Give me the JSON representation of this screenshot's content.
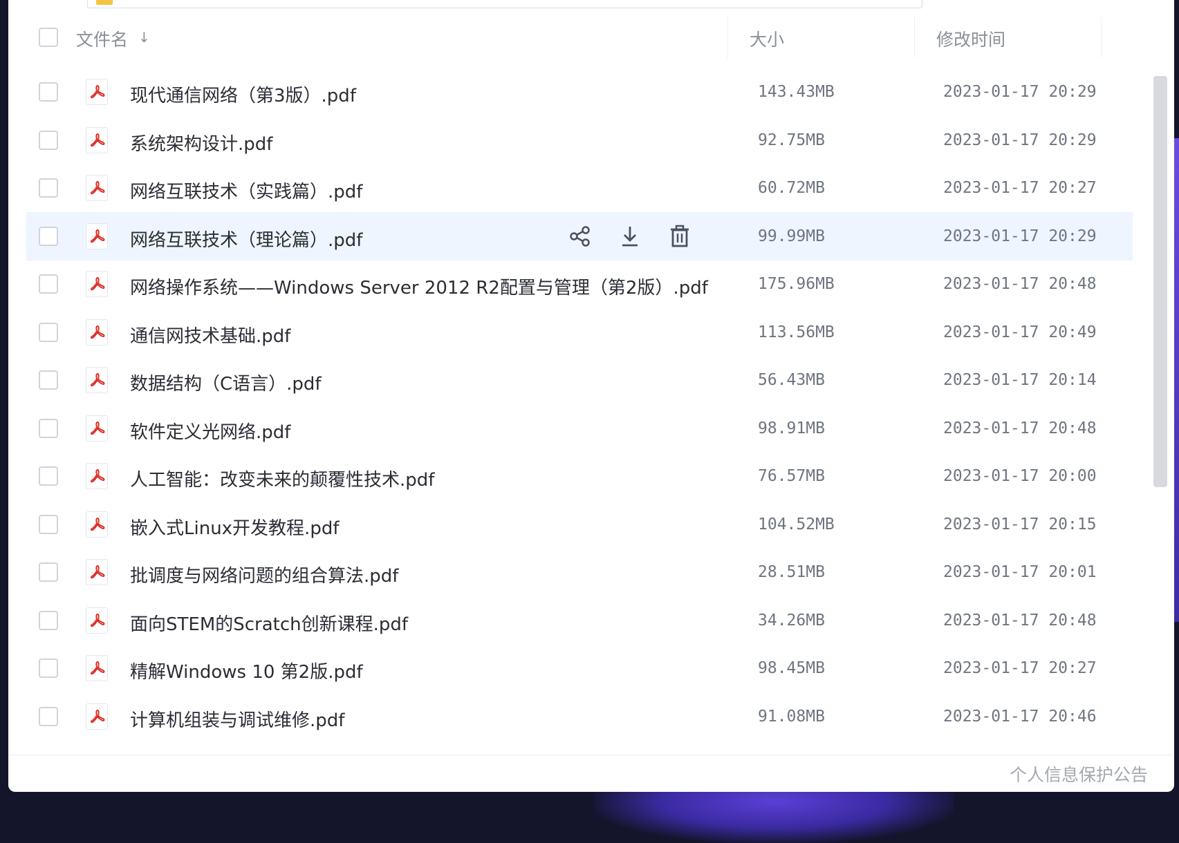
{
  "header": {
    "col_name": "文件名",
    "sort_indicator": "↓",
    "col_size": "大小",
    "col_modified": "修改时间"
  },
  "files": [
    {
      "name": "现代通信网络（第3版）.pdf",
      "size": "143.43MB",
      "modified": "2023-01-17 20:29"
    },
    {
      "name": "系统架构设计.pdf",
      "size": "92.75MB",
      "modified": "2023-01-17 20:29"
    },
    {
      "name": "网络互联技术（实践篇）.pdf",
      "size": "60.72MB",
      "modified": "2023-01-17 20:27"
    },
    {
      "name": "网络互联技术（理论篇）.pdf",
      "size": "99.99MB",
      "modified": "2023-01-17 20:29"
    },
    {
      "name": "网络操作系统——Windows Server 2012 R2配置与管理（第2版）.pdf",
      "size": "175.96MB",
      "modified": "2023-01-17 20:48"
    },
    {
      "name": "通信网技术基础.pdf",
      "size": "113.56MB",
      "modified": "2023-01-17 20:49"
    },
    {
      "name": "数据结构（C语言）.pdf",
      "size": "56.43MB",
      "modified": "2023-01-17 20:14"
    },
    {
      "name": "软件定义光网络.pdf",
      "size": "98.91MB",
      "modified": "2023-01-17 20:48"
    },
    {
      "name": "人工智能：改变未来的颠覆性技术.pdf",
      "size": "76.57MB",
      "modified": "2023-01-17 20:00"
    },
    {
      "name": "嵌入式Linux开发教程.pdf",
      "size": "104.52MB",
      "modified": "2023-01-17 20:15"
    },
    {
      "name": "批调度与网络问题的组合算法.pdf",
      "size": "28.51MB",
      "modified": "2023-01-17 20:01"
    },
    {
      "name": "面向STEM的Scratch创新课程.pdf",
      "size": "34.26MB",
      "modified": "2023-01-17 20:48"
    },
    {
      "name": "精解Windows 10 第2版.pdf",
      "size": "98.45MB",
      "modified": "2023-01-17 20:27"
    },
    {
      "name": "计算机组装与调试维修.pdf",
      "size": "91.08MB",
      "modified": "2023-01-17 20:46"
    }
  ],
  "hovered_row_index": 3,
  "row_actions": [
    "share-icon",
    "download-icon",
    "delete-icon"
  ],
  "file_icon": "pdf-icon",
  "colors": {
    "hover_row": "#eef5fe",
    "pdf_red": "#e0322b",
    "text_primary": "#2a2d33",
    "text_secondary": "#6f7480"
  },
  "footer": {
    "privacy_link": "个人信息保护公告"
  }
}
